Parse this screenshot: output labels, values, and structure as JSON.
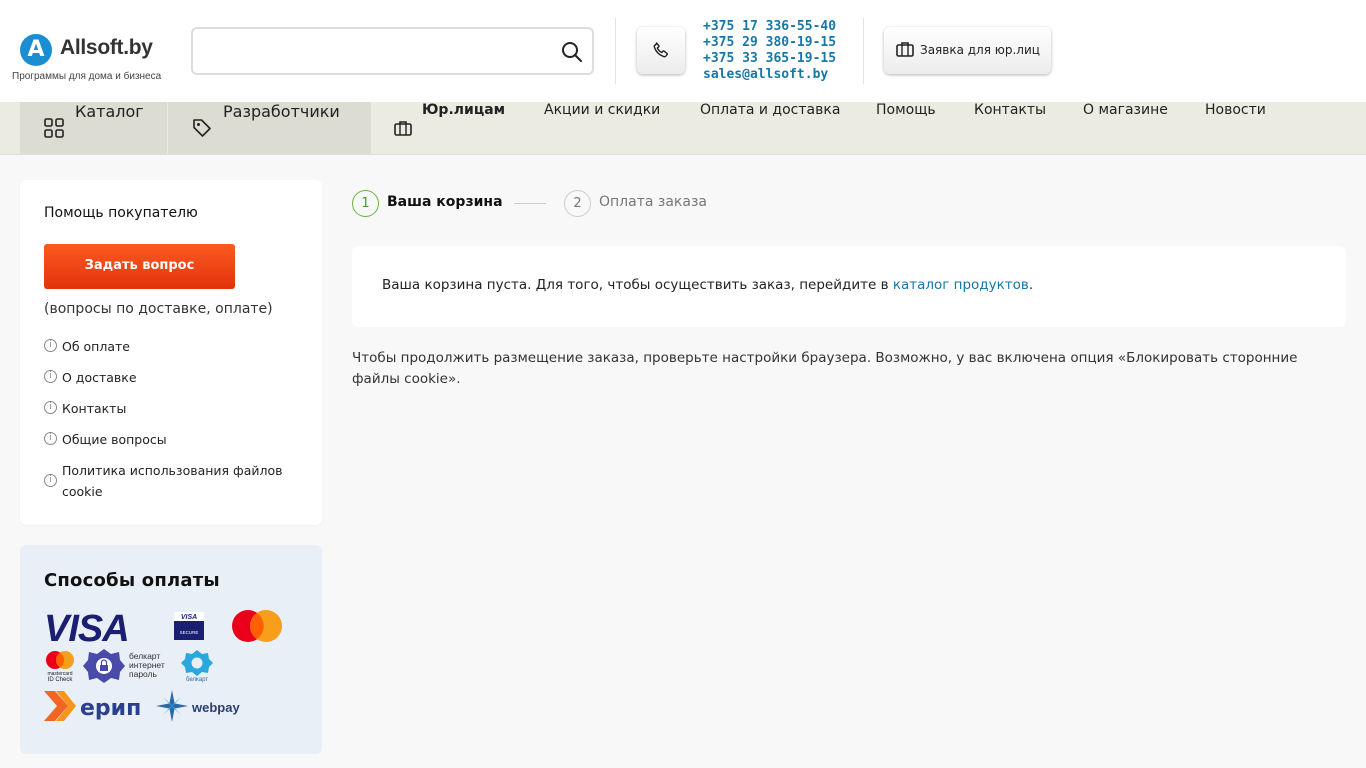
{
  "header": {
    "logo_letter": "A",
    "logo_text": "Allsoft.by",
    "logo_subtitle": "Программы для дома и бизнеса",
    "search_placeholder": "",
    "phones": [
      "+375 17 336-55-40",
      "+375 29 380-19-15",
      "+375 33 365-19-15"
    ],
    "email": "sales@allsoft.by",
    "corp_button": "Заявка для юр.лиц"
  },
  "nav": {
    "catalog": "Каталог",
    "developers": "Разработчики",
    "corporate": "Юр.лицам",
    "items": [
      "Акции и скидки",
      "Оплата и доставка",
      "Помощь",
      "Контакты",
      "О магазине",
      "Новости"
    ]
  },
  "sidebar": {
    "help_title": "Помощь покупателю",
    "ask_button": "Задать вопрос",
    "help_note": "(вопросы по доставке, оплате)",
    "links": [
      "Об оплате",
      "О доставке",
      "Контакты",
      "Общие вопросы",
      "Политика использования файлов cookie"
    ],
    "payment_title": "Способы оплаты",
    "payment_logos": {
      "visa": "VISA",
      "visa_secure_1": "VISA",
      "visa_secure_2": "SECURE",
      "mc_id_1": "mastercard",
      "mc_id_2": "ID Check",
      "belkart_internet": [
        "белкарт",
        "интернет",
        "пароль"
      ],
      "belkart": "белкарт",
      "erip": "ерип",
      "webpay": "webpay"
    }
  },
  "main": {
    "step1_num": "1",
    "step1_label": "Ваша корзина",
    "step2_num": "2",
    "step2_label": "Оплата заказа",
    "cart_text_before": "Ваша корзина пуста. Для того, чтобы осуществить заказ, перейдите в ",
    "cart_link": "каталог продуктов",
    "cart_text_after": ".",
    "cookie_note": "Чтобы продолжить размещение заказа, проверьте настройки браузера. Возможно, у вас включена опция «Блокировать сторонние файлы cookie»."
  },
  "colors": {
    "brand_blue": "#1a8ed1",
    "link_blue": "#1777a6",
    "cta_orange": "#f04a17",
    "step_green": "#6bb34a"
  }
}
